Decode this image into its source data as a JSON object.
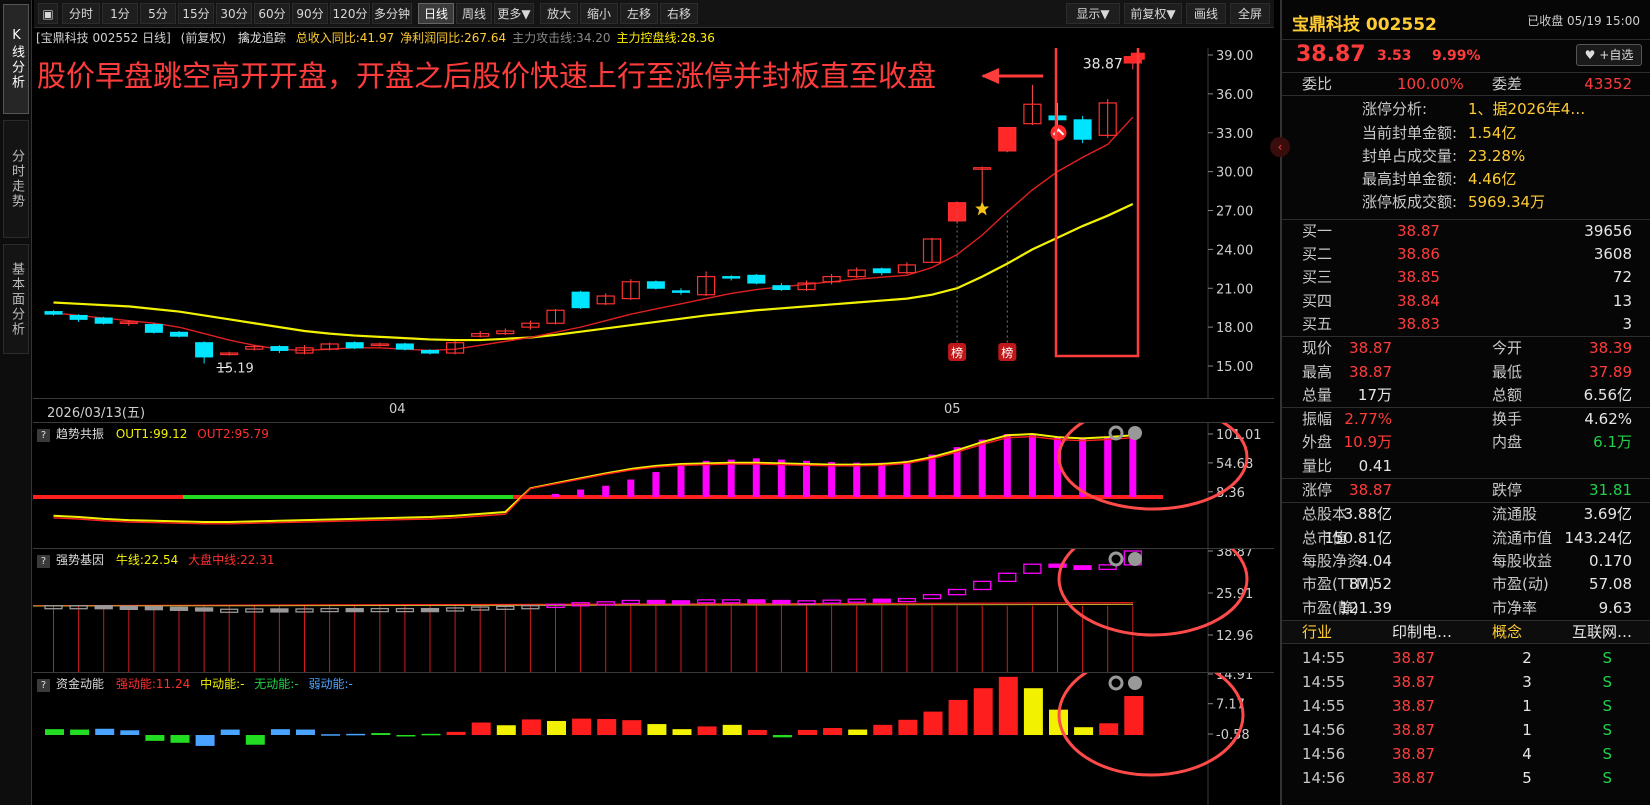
{
  "left_tabs": [
    "K线分析",
    "分时走势",
    "基本面分析"
  ],
  "toolbar": {
    "buttons": [
      "分时",
      "1分",
      "5分",
      "15分",
      "30分",
      "60分",
      "90分",
      "120分",
      "多分钟",
      "日线",
      "周线",
      "更多▼",
      "放大",
      "缩小",
      "左移",
      "右移"
    ],
    "active": "日线",
    "right_buttons": [
      "显示▼",
      "前复权▼",
      "画线",
      "全屏"
    ]
  },
  "info_row": {
    "name": "[宝鼎科技 002552 日线]",
    "adjust": "(前复权)",
    "indicator": "擒龙追踪",
    "items": [
      {
        "label": "总收入同比:41.97",
        "color": "#ffcc33"
      },
      {
        "label": "净利润同比:267.64",
        "color": "#ffcc33"
      },
      {
        "label": "主力攻击线:34.20",
        "color": "#888888"
      },
      {
        "label": "主力控盘线:28.36",
        "color": "#ffee00"
      }
    ]
  },
  "annotation": "股价早盘跳空高开开盘，开盘之后股价快速上行至涨停并封板直至收盘",
  "price_label": "38.87",
  "low_label": "15.19",
  "bang_label": "榜",
  "main_axis": [
    "39.00",
    "36.00",
    "33.00",
    "30.00",
    "27.00",
    "24.00",
    "21.00",
    "18.00",
    "15.00"
  ],
  "date_axis": {
    "first": "2026/03/13(五)",
    "m4": "04",
    "m5": "05"
  },
  "sub1": {
    "title": "趋势共振",
    "out1": "OUT1:99.12",
    "out2": "OUT2:95.79",
    "axis": [
      "101.01",
      "54.68",
      "8.36"
    ]
  },
  "sub2": {
    "title": "强势基因",
    "l1": "牛线:22.54",
    "l2": "大盘中线:22.31",
    "axis": [
      "38.87",
      "25.91",
      "12.96"
    ]
  },
  "sub3": {
    "title": "资金动能",
    "l1": "强动能:11.24",
    "l2": "中动能:-",
    "l3": "无动能:-",
    "l4": "弱动能:-",
    "axis": [
      "14.91",
      "7.17",
      "-0.58"
    ]
  },
  "colors": {
    "up": "#ff3030",
    "down": "#00e5ff",
    "ma_yellow": "#f2f200",
    "ma_red": "#e02020",
    "magenta": "#ff00ff",
    "annotation": "#ff3c3c"
  },
  "chart_data": {
    "type": "candlestick",
    "y_range": [
      15,
      39
    ],
    "candles": [
      {
        "o": 19.2,
        "c": 19.0,
        "h": 19.3,
        "l": 18.9
      },
      {
        "o": 18.9,
        "c": 18.6,
        "h": 19.0,
        "l": 18.4
      },
      {
        "o": 18.7,
        "c": 18.3,
        "h": 18.8,
        "l": 18.2
      },
      {
        "o": 18.3,
        "c": 18.4,
        "h": 18.5,
        "l": 18.1
      },
      {
        "o": 18.2,
        "c": 17.6,
        "h": 18.3,
        "l": 17.5
      },
      {
        "o": 17.6,
        "c": 17.3,
        "h": 17.7,
        "l": 17.2
      },
      {
        "o": 16.8,
        "c": 15.7,
        "h": 16.9,
        "l": 15.19
      },
      {
        "o": 15.9,
        "c": 16.0,
        "h": 16.1,
        "l": 15.8
      },
      {
        "o": 16.3,
        "c": 16.5,
        "h": 16.6,
        "l": 16.2
      },
      {
        "o": 16.5,
        "c": 16.2,
        "h": 16.6,
        "l": 16.0
      },
      {
        "o": 16.0,
        "c": 16.4,
        "h": 16.6,
        "l": 15.9
      },
      {
        "o": 16.3,
        "c": 16.7,
        "h": 16.8,
        "l": 16.2
      },
      {
        "o": 16.8,
        "c": 16.4,
        "h": 16.9,
        "l": 16.3
      },
      {
        "o": 16.6,
        "c": 16.7,
        "h": 16.8,
        "l": 16.5
      },
      {
        "o": 16.7,
        "c": 16.3,
        "h": 16.8,
        "l": 16.2
      },
      {
        "o": 16.2,
        "c": 16.0,
        "h": 16.3,
        "l": 15.9
      },
      {
        "o": 16.0,
        "c": 16.8,
        "h": 16.9,
        "l": 15.9
      },
      {
        "o": 17.3,
        "c": 17.5,
        "h": 17.7,
        "l": 17.2
      },
      {
        "o": 17.5,
        "c": 17.7,
        "h": 17.9,
        "l": 17.4
      },
      {
        "o": 18.0,
        "c": 18.3,
        "h": 18.5,
        "l": 17.8
      },
      {
        "o": 18.3,
        "c": 19.3,
        "h": 19.4,
        "l": 18.2
      },
      {
        "o": 20.7,
        "c": 19.5,
        "h": 20.8,
        "l": 19.4
      },
      {
        "o": 19.8,
        "c": 20.4,
        "h": 20.6,
        "l": 19.7
      },
      {
        "o": 20.2,
        "c": 21.5,
        "h": 21.7,
        "l": 20.1
      },
      {
        "o": 21.5,
        "c": 21.0,
        "h": 21.6,
        "l": 20.9
      },
      {
        "o": 20.8,
        "c": 20.7,
        "h": 21.0,
        "l": 20.5
      },
      {
        "o": 20.5,
        "c": 21.9,
        "h": 22.3,
        "l": 20.4
      },
      {
        "o": 21.9,
        "c": 21.8,
        "h": 22.0,
        "l": 21.6
      },
      {
        "o": 22.0,
        "c": 21.4,
        "h": 22.1,
        "l": 21.3
      },
      {
        "o": 21.2,
        "c": 20.9,
        "h": 21.4,
        "l": 20.8
      },
      {
        "o": 20.9,
        "c": 21.4,
        "h": 21.6,
        "l": 20.8
      },
      {
        "o": 21.5,
        "c": 21.9,
        "h": 22.1,
        "l": 21.3
      },
      {
        "o": 21.9,
        "c": 22.4,
        "h": 22.6,
        "l": 21.8
      },
      {
        "o": 22.5,
        "c": 22.2,
        "h": 22.6,
        "l": 22.0
      },
      {
        "o": 22.2,
        "c": 22.8,
        "h": 23.0,
        "l": 22.1
      },
      {
        "o": 23.0,
        "c": 24.8,
        "h": 24.9,
        "l": 23.0
      },
      {
        "o": 26.2,
        "c": 27.6,
        "h": 27.7,
        "l": 26.0
      },
      {
        "o": 30.2,
        "c": 30.3,
        "h": 30.4,
        "l": 26.8
      },
      {
        "o": 31.6,
        "c": 33.4,
        "h": 33.4,
        "l": 31.5
      },
      {
        "o": 33.7,
        "c": 35.2,
        "h": 36.7,
        "l": 33.6
      },
      {
        "o": 34.3,
        "c": 34.0,
        "h": 35.3,
        "l": 33.0
      },
      {
        "o": 34.0,
        "c": 32.5,
        "h": 34.3,
        "l": 32.2
      },
      {
        "o": 32.8,
        "c": 35.3,
        "h": 35.6,
        "l": 32.6
      },
      {
        "o": 38.39,
        "c": 38.87,
        "h": 38.87,
        "l": 37.89
      }
    ],
    "ma_yellow": [
      19.9,
      19.8,
      19.7,
      19.6,
      19.4,
      19.2,
      18.9,
      18.6,
      18.3,
      18.0,
      17.7,
      17.5,
      17.35,
      17.25,
      17.15,
      17.05,
      17.0,
      17.0,
      17.1,
      17.2,
      17.4,
      17.65,
      17.9,
      18.15,
      18.4,
      18.65,
      18.9,
      19.1,
      19.3,
      19.45,
      19.6,
      19.75,
      19.9,
      20.05,
      20.2,
      20.5,
      21.0,
      21.9,
      22.9,
      24.0,
      24.9,
      25.8,
      26.6,
      27.5
    ],
    "ma_red": [
      19.1,
      18.9,
      18.7,
      18.5,
      18.3,
      18.0,
      17.5,
      17.0,
      16.6,
      16.3,
      16.2,
      16.3,
      16.4,
      16.4,
      16.3,
      16.2,
      16.3,
      16.6,
      16.9,
      17.2,
      17.6,
      18.0,
      18.5,
      19.0,
      19.4,
      19.8,
      20.2,
      20.6,
      20.9,
      21.1,
      21.3,
      21.5,
      21.7,
      21.85,
      22.0,
      22.6,
      23.6,
      25.1,
      26.9,
      28.6,
      30.0,
      31.1,
      32.1,
      34.2
    ],
    "sub1_bars": [
      0,
      0,
      0,
      0,
      0,
      0,
      0,
      0,
      0,
      0,
      0,
      0,
      0,
      0,
      0,
      0,
      0,
      0,
      0,
      0,
      5,
      12,
      18,
      28,
      40,
      50,
      58,
      60,
      62,
      60,
      58,
      56,
      55,
      55,
      58,
      68,
      80,
      92,
      101,
      99,
      95,
      94,
      95,
      99
    ],
    "sub1_line_yellow": [
      2,
      0,
      -3,
      -5,
      -6,
      -7,
      -8,
      -8,
      -7,
      -6,
      -5,
      -4,
      -3,
      -2,
      -1,
      0,
      2,
      5,
      8,
      14,
      22,
      30,
      38,
      45,
      50,
      53,
      54,
      55,
      55,
      54,
      53,
      52,
      52,
      53,
      56,
      64,
      75,
      88,
      99,
      101,
      96,
      94,
      96,
      99
    ],
    "sub2_vals": [
      22.0,
      22.0,
      21.8,
      21.7,
      21.5,
      21.3,
      20.8,
      20.9,
      21.0,
      20.9,
      21.0,
      21.1,
      21.0,
      21.1,
      21.1,
      21.0,
      21.3,
      21.6,
      21.8,
      22.0,
      22.4,
      22.9,
      23.2,
      23.6,
      23.5,
      23.4,
      23.8,
      23.8,
      23.6,
      23.4,
      23.5,
      23.7,
      24.0,
      23.9,
      24.2,
      25.4,
      27.0,
      29.5,
      32.0,
      34.8,
      34.3,
      33.2,
      34.6,
      38.87
    ],
    "sub3_vals": [
      1.5,
      1.4,
      1.6,
      1.2,
      -1.5,
      -2.0,
      -2.8,
      1.4,
      -2.5,
      1.5,
      1.4,
      0.2,
      0.3,
      0.5,
      -0.2,
      0.3,
      0.8,
      3.2,
      2.5,
      4.0,
      3.6,
      4.2,
      4.1,
      3.8,
      2.8,
      1.5,
      2.2,
      2.6,
      1.3,
      -0.6,
      1.3,
      1.8,
      1.4,
      2.6,
      3.9,
      6.0,
      9.0,
      12.0,
      14.91,
      12.0,
      6.5,
      2.0,
      3.0,
      10.0
    ],
    "sub3_colors": [
      "g",
      "g",
      "b",
      "b",
      "g",
      "g",
      "b",
      "b",
      "g",
      "b",
      "b",
      "b",
      "b",
      "g",
      "g",
      "g",
      "r",
      "r",
      "y",
      "r",
      "y",
      "r",
      "r",
      "r",
      "y",
      "y",
      "r",
      "y",
      "r",
      "g",
      "r",
      "r",
      "y",
      "r",
      "r",
      "r",
      "r",
      "r",
      "r",
      "y",
      "y",
      "y",
      "r",
      "r"
    ]
  },
  "right": {
    "title": "宝鼎科技 002552",
    "status": "已收盘 05/19 15:00",
    "price": "38.87",
    "change": "3.53",
    "pct": "9.99%",
    "watch": "+自选",
    "weibi_label": "委比",
    "weibi": "100.00%",
    "weicha_label": "委差",
    "weicha": "43352",
    "limit_info": [
      {
        "k": "涨停分析:",
        "v": "1、据2026年4…",
        "c": "gold"
      },
      {
        "k": "当前封单金额:",
        "v": "1.54亿",
        "c": "gold"
      },
      {
        "k": "封单占成交量:",
        "v": "23.28%",
        "c": "gold"
      },
      {
        "k": "最高封单金额:",
        "v": "4.46亿",
        "c": "gold"
      },
      {
        "k": "涨停板成交额:",
        "v": "5969.34万",
        "c": "gold"
      }
    ],
    "bids": [
      {
        "k": "买一",
        "p": "38.87",
        "v": "39656"
      },
      {
        "k": "买二",
        "p": "38.86",
        "v": "3608"
      },
      {
        "k": "买三",
        "p": "38.85",
        "v": "72"
      },
      {
        "k": "买四",
        "p": "38.84",
        "v": "13"
      },
      {
        "k": "买五",
        "p": "38.83",
        "v": "3"
      }
    ],
    "stats1": [
      {
        "a": "现价",
        "av": "38.87",
        "ac": "red",
        "b": "今开",
        "bv": "38.39",
        "bc": "red"
      },
      {
        "a": "最高",
        "av": "38.87",
        "ac": "red",
        "b": "最低",
        "bv": "37.89",
        "bc": "red"
      },
      {
        "a": "总量",
        "av": "17万",
        "ac": "white",
        "b": "总额",
        "bv": "6.56亿",
        "bc": "white"
      }
    ],
    "stats2": [
      {
        "a": "振幅",
        "av": "2.77%",
        "ac": "red",
        "b": "换手",
        "bv": "4.62%",
        "bc": "white"
      },
      {
        "a": "外盘",
        "av": "10.9万",
        "ac": "red",
        "b": "内盘",
        "bv": "6.1万",
        "bc": "green"
      },
      {
        "a": "量比",
        "av": "0.41",
        "ac": "white",
        "b": "",
        "bv": "",
        "bc": "white"
      }
    ],
    "stats3": [
      {
        "a": "涨停",
        "av": "38.87",
        "ac": "red",
        "b": "跌停",
        "bv": "31.81",
        "bc": "green"
      }
    ],
    "stats4": [
      {
        "a": "总股本",
        "av": "3.88亿",
        "ac": "white",
        "b": "流通股",
        "bv": "3.69亿",
        "bc": "white"
      },
      {
        "a": "总市值",
        "av": "150.81亿",
        "ac": "white",
        "b": "流通市值",
        "bv": "143.24亿",
        "bc": "white"
      },
      {
        "a": "每股净资",
        "av": "4.04",
        "ac": "white",
        "b": "每股收益",
        "bv": "0.170",
        "bc": "white"
      },
      {
        "a": "市盈(TTM)",
        "av": "87.52",
        "ac": "white",
        "b": "市盈(动)",
        "bv": "57.08",
        "bc": "white"
      },
      {
        "a": "市盈(静)",
        "av": "121.39",
        "ac": "white",
        "b": "市净率",
        "bv": "9.63",
        "bc": "white"
      }
    ],
    "industry": {
      "a": "行业",
      "av": "印制电…",
      "b": "概念",
      "bv": "互联网…"
    },
    "ticks": [
      {
        "t": "14:55",
        "p": "38.87",
        "v": "2",
        "s": "S"
      },
      {
        "t": "14:55",
        "p": "38.87",
        "v": "3",
        "s": "S"
      },
      {
        "t": "14:55",
        "p": "38.87",
        "v": "1",
        "s": "S"
      },
      {
        "t": "14:56",
        "p": "38.87",
        "v": "1",
        "s": "S"
      },
      {
        "t": "14:56",
        "p": "38.87",
        "v": "4",
        "s": "S"
      },
      {
        "t": "14:56",
        "p": "38.87",
        "v": "5",
        "s": "S"
      }
    ]
  }
}
